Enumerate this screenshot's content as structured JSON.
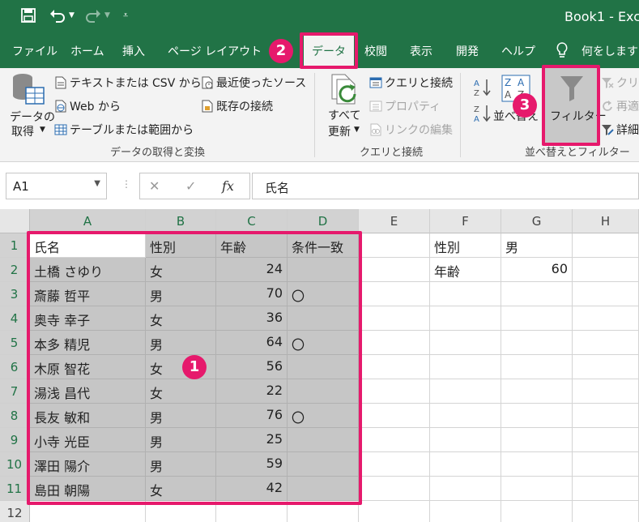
{
  "titlebar": {
    "title": "Book1  -  Exc",
    "save_icon": "save-icon",
    "undo_icon": "undo-icon",
    "redo_icon": "redo-icon"
  },
  "tabs": [
    {
      "label": "ファイル"
    },
    {
      "label": "ホーム"
    },
    {
      "label": "挿入"
    },
    {
      "label": "ページ レイアウト"
    },
    {
      "label": "データ",
      "active": true
    },
    {
      "label": "校閲"
    },
    {
      "label": "表示"
    },
    {
      "label": "開発"
    },
    {
      "label": "ヘルプ"
    },
    {
      "label": "何をしますか"
    }
  ],
  "ribbon": {
    "get_data": {
      "data_btn_line1": "データの",
      "data_btn_line2": "取得",
      "text_csv": "テキストまたは CSV から",
      "web": "Web から",
      "table_range": "テーブルまたは範囲から",
      "recent_sources": "最近使ったソース",
      "existing_connections": "既存の接続",
      "group_label": "データの取得と変換"
    },
    "queries": {
      "refresh_line1": "すべて",
      "refresh_line2": "更新",
      "queries_connections": "クエリと接続",
      "properties": "プロパティ",
      "edit_links": "リンクの編集",
      "group_label": "クエリと接続"
    },
    "sort_filter": {
      "sort_label": "並べ替え",
      "filter_label": "フィルター",
      "clear": "クリア",
      "reapply": "再適",
      "advanced": "詳細",
      "group_label": "並べ替えとフィルター"
    }
  },
  "formula_bar": {
    "name_box": "A1",
    "fx": "fx",
    "value": "氏名"
  },
  "sheet": {
    "columns": [
      "A",
      "B",
      "C",
      "D",
      "E",
      "F",
      "G",
      "H"
    ],
    "rows": [
      "1",
      "2",
      "3",
      "4",
      "5",
      "6",
      "7",
      "8",
      "9",
      "10",
      "11",
      "12"
    ],
    "table": [
      [
        "氏名",
        "性別",
        "年齢",
        "条件一致"
      ],
      [
        "土橋 さゆり",
        "女",
        "24",
        ""
      ],
      [
        "斎藤 哲平",
        "男",
        "70",
        "〇"
      ],
      [
        "奥寺 幸子",
        "女",
        "36",
        ""
      ],
      [
        "本多 精児",
        "男",
        "64",
        "〇"
      ],
      [
        "木原 智花",
        "女",
        "56",
        ""
      ],
      [
        "湯浅 昌代",
        "女",
        "22",
        ""
      ],
      [
        "長友 敏和",
        "男",
        "76",
        "〇"
      ],
      [
        "小寺 光臣",
        "男",
        "25",
        ""
      ],
      [
        "澤田 陽介",
        "男",
        "59",
        ""
      ],
      [
        "島田 朝陽",
        "女",
        "42",
        ""
      ]
    ],
    "criteria": [
      [
        "性別",
        "男"
      ],
      [
        "年齢",
        "60"
      ]
    ]
  },
  "callouts": [
    "1",
    "2",
    "3"
  ],
  "colors": {
    "excel_green": "#217346",
    "highlight": "#e6196c",
    "selection": "#c6c6c6"
  }
}
